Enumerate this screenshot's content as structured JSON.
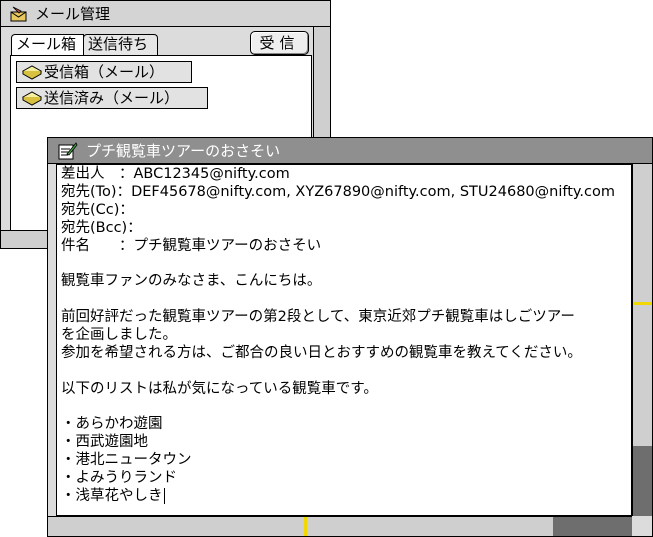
{
  "mail_window": {
    "title": "メール管理",
    "tabs": [
      {
        "label": "メール箱"
      },
      {
        "label": "送信待ち"
      }
    ],
    "receive_button": "受信",
    "folders": [
      {
        "label": "受信箱（メール）",
        "icon": "mailbox-icon"
      },
      {
        "label": "送信済み（メール）",
        "icon": "mailbox-icon"
      }
    ]
  },
  "message_window": {
    "title": "プチ観覧車ツアーのおさそい",
    "lines": [
      "差出人　：ABC12345@nifty.com",
      "宛先(To)：DEF45678@nifty.com, XYZ67890@nifty.com, STU24680@nifty.com",
      "宛先(Cc)：",
      "宛先(Bcc)：",
      "件名　　：プチ観覧車ツアーのおさそい",
      "",
      "観覧車ファンのみなさま、こんにちは。",
      "",
      "前回好評だった観覧車ツアーの第2段として、東京近郊プチ観覧車はしごツアー",
      "を企画しました。",
      "参加を希望される方は、ご都合の良い日とおすすめの観覧車を教えてください。",
      "",
      "以下のリストは私が気になっている観覧車です。",
      "",
      "・あらかわ遊園",
      "・西武遊園地",
      "・港北ニュータウン",
      "・よみうりランド",
      "・浅草花やしき"
    ]
  },
  "colors": {
    "active_titlebar": "#8f8f8f",
    "inactive_titlebar": "#d4d4d4",
    "scroll_marker": "#f0d800",
    "scroll_thumb": "#6e6e6e"
  }
}
